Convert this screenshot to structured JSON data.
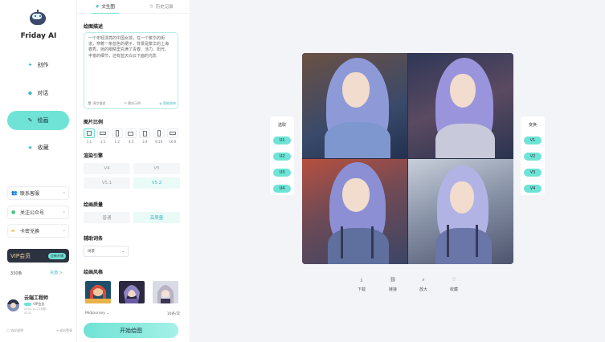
{
  "app": {
    "name": "Friday AI"
  },
  "nav": [
    {
      "label": "创作",
      "icon": "sparkle-icon",
      "active": false
    },
    {
      "label": "对话",
      "icon": "chat-icon",
      "active": false
    },
    {
      "label": "绘画",
      "icon": "paint-icon",
      "active": true
    },
    {
      "label": "收藏",
      "icon": "star-icon",
      "active": false
    }
  ],
  "links": [
    {
      "label": "联系客服",
      "icon": "service-icon"
    },
    {
      "label": "关注公众号",
      "icon": "wechat-icon"
    },
    {
      "label": "卡密兑换",
      "icon": "ticket-icon"
    }
  ],
  "vip": {
    "label": "VIP会员",
    "button": "全新开通",
    "points": "330条",
    "recharge": "充值 >"
  },
  "user": {
    "name": "云端工程师",
    "badge": "VIP会员",
    "date": "2024-10-21到期",
    "id": "ID:32"
  },
  "footer": {
    "left": "协议说明",
    "right": "退出登录"
  },
  "panel": {
    "tabs": [
      {
        "label": "文生图",
        "active": true
      },
      {
        "label": "历史记录",
        "active": false
      }
    ],
    "prompt_title": "绘图描述",
    "prompt_text": "一个年轻漂亮的中国女孩，在一个繁华的街道，穿着一条蓝色的裙子，背景是繁华的上海春秀。她的眼睛里充满了青春、活力、阳光、丰富的细节，还有蓝天白云下面的光影",
    "prompt_tools": {
      "clear": "清空描述",
      "random": "随机示例",
      "optimize": "智能修饰"
    },
    "ratio_title": "图片比例",
    "ratios": [
      {
        "label": "1:1",
        "active": true
      },
      {
        "label": "2:1",
        "active": false
      },
      {
        "label": "1:2",
        "active": false
      },
      {
        "label": "4:3",
        "active": false
      },
      {
        "label": "3:4",
        "active": false
      },
      {
        "label": "9:16",
        "active": false
      },
      {
        "label": "16:9",
        "active": false
      }
    ],
    "engine_title": "渲染引擎",
    "engines": [
      {
        "label": "V4",
        "active": false
      },
      {
        "label": "V5",
        "active": false
      },
      {
        "label": "V5.1",
        "active": false
      },
      {
        "label": "V5.2",
        "active": true
      }
    ],
    "quality_title": "绘画质量",
    "qualities": [
      {
        "label": "普通",
        "active": false
      },
      {
        "label": "高质量",
        "active": true
      }
    ],
    "aux_title": "辅助词条",
    "aux_select": "场景",
    "style_title": "绘画风格",
    "model": "Midjourney",
    "cost": "10条/次",
    "start": "开始绘图"
  },
  "main": {
    "left_card": {
      "title": "选取",
      "buttons": [
        "U1",
        "U2",
        "U3",
        "U4"
      ]
    },
    "right_card": {
      "title": "变换",
      "buttons": [
        "V1",
        "V2",
        "V3",
        "V4"
      ]
    },
    "actions": [
      {
        "label": "下载",
        "icon": "download-icon"
      },
      {
        "label": "链接",
        "icon": "link-icon"
      },
      {
        "label": "放大",
        "icon": "zoom-icon"
      },
      {
        "label": "收藏",
        "icon": "heart-icon"
      }
    ]
  },
  "colors": {
    "accent": "#6fe3d5",
    "accent_text": "#3fb7c6",
    "dark": "#2c3240"
  }
}
